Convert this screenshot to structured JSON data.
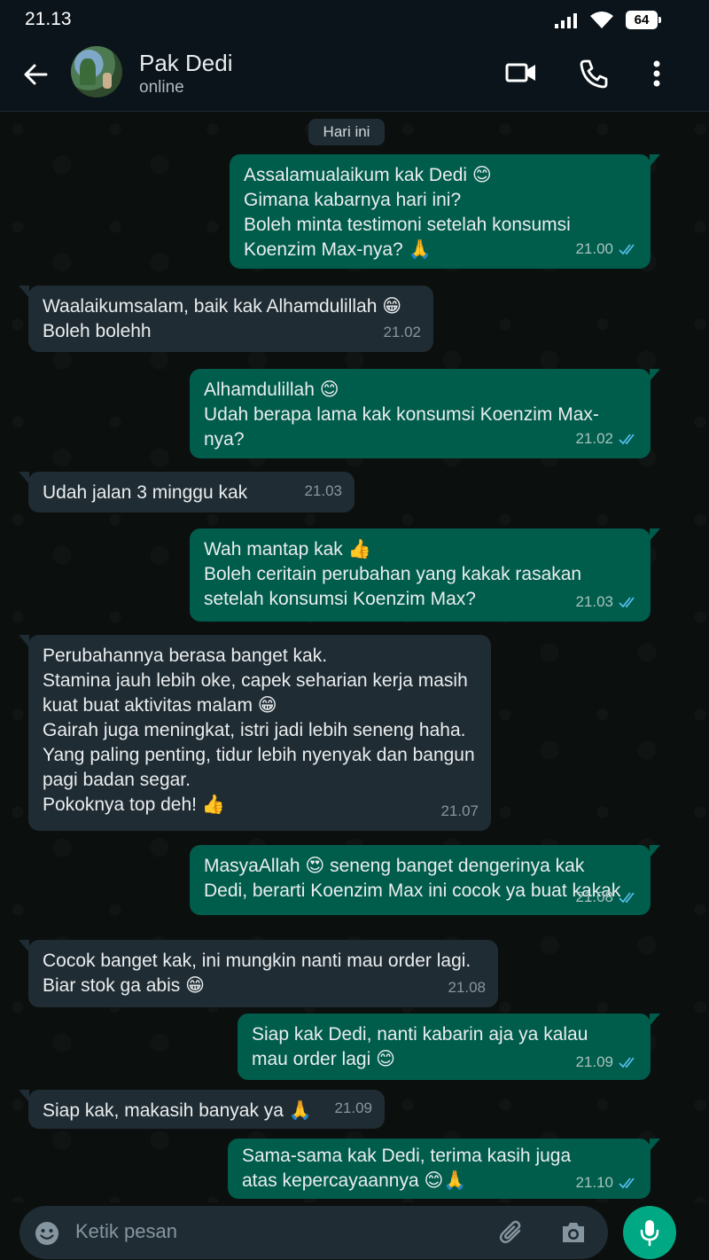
{
  "status_bar": {
    "time": "21.13",
    "battery": "64"
  },
  "header": {
    "contact_name": "Pak Dedi",
    "contact_status": "online"
  },
  "chat": {
    "date_chip": "Hari ini",
    "messages": [
      {
        "dir": "out",
        "text": "Assalamualaikum kak Dedi 😊\nGimana kabarnya hari ini?\nBoleh minta testimoni setelah konsumsi\nKoenzim Max-nya? 🙏",
        "time": "21.00",
        "read": true
      },
      {
        "dir": "in",
        "text": "Waalaikumsalam, baik kak Alhamdulillah 😁\nBoleh bolehh",
        "time": "21.02"
      },
      {
        "dir": "out",
        "text": "Alhamdulillah 😊\nUdah berapa lama kak konsumsi Koenzim Max-nya?",
        "time": "21.02",
        "read": true
      },
      {
        "dir": "in",
        "text": "Udah jalan 3 minggu kak",
        "time": "21.03"
      },
      {
        "dir": "out",
        "text": "Wah mantap kak 👍\nBoleh ceritain perubahan yang kakak rasakan\nsetelah konsumsi Koenzim Max?",
        "time": "21.03",
        "read": true
      },
      {
        "dir": "in",
        "text": "Perubahannya berasa banget kak.\nStamina jauh lebih oke, capek seharian kerja masih\nkuat buat aktivitas malam 😁\nGairah juga meningkat, istri jadi lebih seneng haha.\nYang paling penting, tidur lebih nyenyak dan bangun\npagi badan segar.\nPokoknya top deh! 👍",
        "time": "21.07"
      },
      {
        "dir": "out",
        "text": "MasyaAllah 😍 seneng banget dengerinya kak\nDedi, berarti Koenzim Max ini cocok ya buat kakak",
        "time": "21.08",
        "read": true
      },
      {
        "dir": "in",
        "text": "Cocok banget kak, ini mungkin nanti mau order lagi.\nBiar stok ga abis 😁",
        "time": "21.08"
      },
      {
        "dir": "out",
        "text": "Siap kak Dedi, nanti kabarin aja ya kalau\nmau order lagi 😊",
        "time": "21.09",
        "read": true
      },
      {
        "dir": "in",
        "text": "Siap kak, makasih banyak ya 🙏",
        "time": "21.09"
      },
      {
        "dir": "out",
        "text": "Sama-sama kak Dedi, terima kasih juga\natas kepercayaannya 😊🙏",
        "time": "21.10",
        "read": true
      }
    ]
  },
  "input": {
    "placeholder": "Ketik pesan"
  },
  "icons": {
    "back": "arrow-left-icon",
    "video": "video-call-icon",
    "call": "phone-icon",
    "menu": "more-vert-icon",
    "emoji": "emoji-icon",
    "attach": "paperclip-icon",
    "camera": "camera-icon",
    "mic": "mic-icon"
  },
  "colors": {
    "outgoing": "#005c4b",
    "incoming": "#202c33",
    "accent": "#00a884",
    "read_tick": "#53bdeb"
  }
}
